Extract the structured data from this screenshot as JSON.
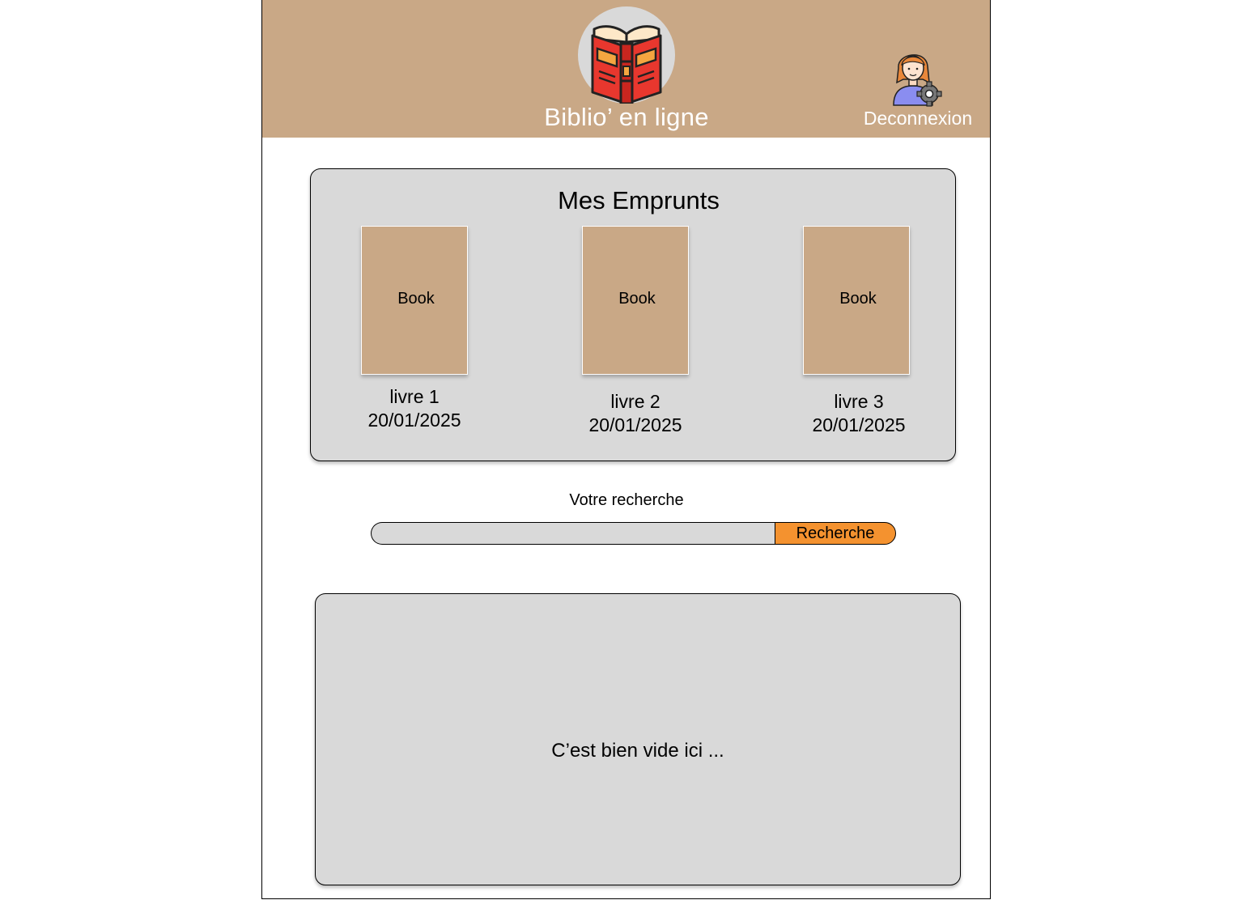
{
  "header": {
    "app_title": "Biblio’ en ligne",
    "logo_icon": "open-book-icon",
    "user_icon": "user-settings-icon",
    "logout_label": "Deconnexion",
    "background_color": "#c9a886"
  },
  "loans": {
    "title": "Mes Emprunts",
    "books": [
      {
        "cover_label": "Book",
        "title": "livre 1",
        "date": "20/01/2025"
      },
      {
        "cover_label": "Book",
        "title": "livre 2",
        "date": "20/01/2025"
      },
      {
        "cover_label": "Book",
        "title": "livre 3",
        "date": "20/01/2025"
      }
    ]
  },
  "search": {
    "label": "Votre recherche",
    "value": "",
    "placeholder": "",
    "button_label": "Recherche",
    "button_color": "#f4922f"
  },
  "results": {
    "empty_message": "C’est bien vide ici ..."
  }
}
